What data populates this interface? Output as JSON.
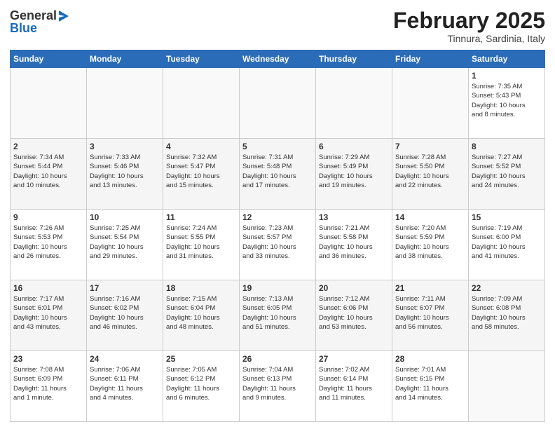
{
  "header": {
    "logo_general": "General",
    "logo_blue": "Blue",
    "month_title": "February 2025",
    "location": "Tinnura, Sardinia, Italy"
  },
  "days_of_week": [
    "Sunday",
    "Monday",
    "Tuesday",
    "Wednesday",
    "Thursday",
    "Friday",
    "Saturday"
  ],
  "weeks": [
    [
      {
        "day": "",
        "info": ""
      },
      {
        "day": "",
        "info": ""
      },
      {
        "day": "",
        "info": ""
      },
      {
        "day": "",
        "info": ""
      },
      {
        "day": "",
        "info": ""
      },
      {
        "day": "",
        "info": ""
      },
      {
        "day": "1",
        "info": "Sunrise: 7:35 AM\nSunset: 5:43 PM\nDaylight: 10 hours\nand 8 minutes."
      }
    ],
    [
      {
        "day": "2",
        "info": "Sunrise: 7:34 AM\nSunset: 5:44 PM\nDaylight: 10 hours\nand 10 minutes."
      },
      {
        "day": "3",
        "info": "Sunrise: 7:33 AM\nSunset: 5:46 PM\nDaylight: 10 hours\nand 13 minutes."
      },
      {
        "day": "4",
        "info": "Sunrise: 7:32 AM\nSunset: 5:47 PM\nDaylight: 10 hours\nand 15 minutes."
      },
      {
        "day": "5",
        "info": "Sunrise: 7:31 AM\nSunset: 5:48 PM\nDaylight: 10 hours\nand 17 minutes."
      },
      {
        "day": "6",
        "info": "Sunrise: 7:29 AM\nSunset: 5:49 PM\nDaylight: 10 hours\nand 19 minutes."
      },
      {
        "day": "7",
        "info": "Sunrise: 7:28 AM\nSunset: 5:50 PM\nDaylight: 10 hours\nand 22 minutes."
      },
      {
        "day": "8",
        "info": "Sunrise: 7:27 AM\nSunset: 5:52 PM\nDaylight: 10 hours\nand 24 minutes."
      }
    ],
    [
      {
        "day": "9",
        "info": "Sunrise: 7:26 AM\nSunset: 5:53 PM\nDaylight: 10 hours\nand 26 minutes."
      },
      {
        "day": "10",
        "info": "Sunrise: 7:25 AM\nSunset: 5:54 PM\nDaylight: 10 hours\nand 29 minutes."
      },
      {
        "day": "11",
        "info": "Sunrise: 7:24 AM\nSunset: 5:55 PM\nDaylight: 10 hours\nand 31 minutes."
      },
      {
        "day": "12",
        "info": "Sunrise: 7:23 AM\nSunset: 5:57 PM\nDaylight: 10 hours\nand 33 minutes."
      },
      {
        "day": "13",
        "info": "Sunrise: 7:21 AM\nSunset: 5:58 PM\nDaylight: 10 hours\nand 36 minutes."
      },
      {
        "day": "14",
        "info": "Sunrise: 7:20 AM\nSunset: 5:59 PM\nDaylight: 10 hours\nand 38 minutes."
      },
      {
        "day": "15",
        "info": "Sunrise: 7:19 AM\nSunset: 6:00 PM\nDaylight: 10 hours\nand 41 minutes."
      }
    ],
    [
      {
        "day": "16",
        "info": "Sunrise: 7:17 AM\nSunset: 6:01 PM\nDaylight: 10 hours\nand 43 minutes."
      },
      {
        "day": "17",
        "info": "Sunrise: 7:16 AM\nSunset: 6:02 PM\nDaylight: 10 hours\nand 46 minutes."
      },
      {
        "day": "18",
        "info": "Sunrise: 7:15 AM\nSunset: 6:04 PM\nDaylight: 10 hours\nand 48 minutes."
      },
      {
        "day": "19",
        "info": "Sunrise: 7:13 AM\nSunset: 6:05 PM\nDaylight: 10 hours\nand 51 minutes."
      },
      {
        "day": "20",
        "info": "Sunrise: 7:12 AM\nSunset: 6:06 PM\nDaylight: 10 hours\nand 53 minutes."
      },
      {
        "day": "21",
        "info": "Sunrise: 7:11 AM\nSunset: 6:07 PM\nDaylight: 10 hours\nand 56 minutes."
      },
      {
        "day": "22",
        "info": "Sunrise: 7:09 AM\nSunset: 6:08 PM\nDaylight: 10 hours\nand 58 minutes."
      }
    ],
    [
      {
        "day": "23",
        "info": "Sunrise: 7:08 AM\nSunset: 6:09 PM\nDaylight: 11 hours\nand 1 minute."
      },
      {
        "day": "24",
        "info": "Sunrise: 7:06 AM\nSunset: 6:11 PM\nDaylight: 11 hours\nand 4 minutes."
      },
      {
        "day": "25",
        "info": "Sunrise: 7:05 AM\nSunset: 6:12 PM\nDaylight: 11 hours\nand 6 minutes."
      },
      {
        "day": "26",
        "info": "Sunrise: 7:04 AM\nSunset: 6:13 PM\nDaylight: 11 hours\nand 9 minutes."
      },
      {
        "day": "27",
        "info": "Sunrise: 7:02 AM\nSunset: 6:14 PM\nDaylight: 11 hours\nand 11 minutes."
      },
      {
        "day": "28",
        "info": "Sunrise: 7:01 AM\nSunset: 6:15 PM\nDaylight: 11 hours\nand 14 minutes."
      },
      {
        "day": "",
        "info": ""
      }
    ]
  ]
}
